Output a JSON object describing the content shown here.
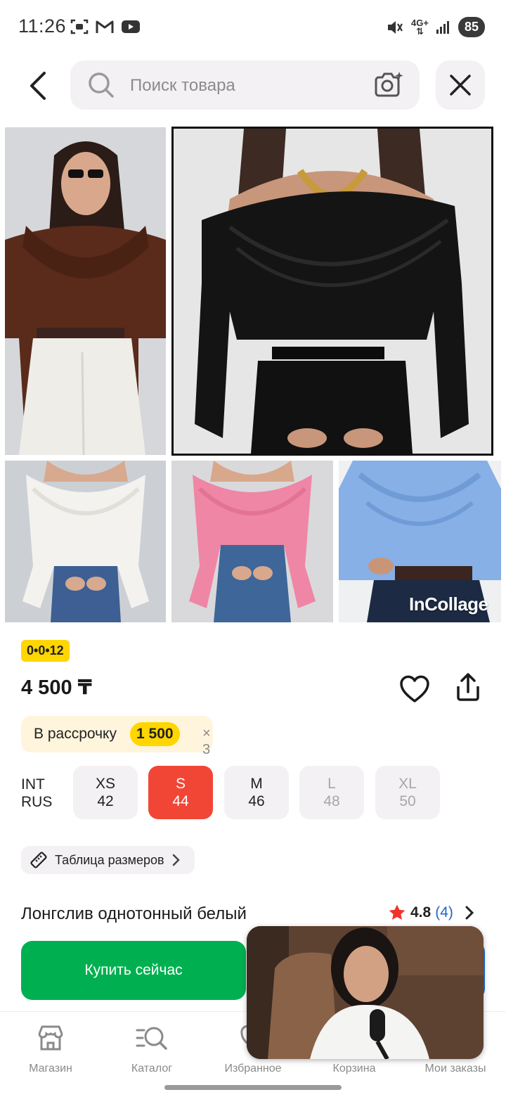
{
  "status_bar": {
    "time": "11:26",
    "network": "4G+",
    "battery": "85",
    "icons_left": [
      "screenshot-icon",
      "gmail-icon",
      "youtube-icon"
    ],
    "icons_right": [
      "mute-icon",
      "network-icon",
      "signal-icon",
      "battery-icon"
    ]
  },
  "header": {
    "search_placeholder": "Поиск товара",
    "icons": [
      "back-arrow-icon",
      "search-icon",
      "camera-search-icon",
      "close-icon"
    ]
  },
  "gallery": {
    "watermark": "InCollage",
    "photos": [
      "brown off-shoulder top",
      "black off-shoulder top",
      "white off-shoulder top",
      "pink off-shoulder top",
      "blue off-shoulder top"
    ]
  },
  "product": {
    "promo_badge": "0•0•12",
    "price": "4 500 ₸",
    "installment": {
      "label": "В рассрочку",
      "amount": "1 500",
      "multiplier": "× 3"
    },
    "size_legend": {
      "int": "INT",
      "rus": "RUS"
    },
    "sizes": [
      {
        "int": "XS",
        "rus": "42",
        "state": "available"
      },
      {
        "int": "S",
        "rus": "44",
        "state": "selected"
      },
      {
        "int": "M",
        "rus": "46",
        "state": "available"
      },
      {
        "int": "L",
        "rus": "48",
        "state": "unavailable"
      },
      {
        "int": "XL",
        "rus": "50",
        "state": "unavailable"
      }
    ],
    "size_table_label": "Таблица размеров",
    "title": "Лонгслив однотонный белый",
    "rating": "4.8",
    "reviews": "(4)"
  },
  "actions": {
    "buy_now": "Купить сейчас"
  },
  "bottom_nav": [
    {
      "label": "Магазин",
      "icon": "store-icon"
    },
    {
      "label": "Каталог",
      "icon": "catalog-search-icon"
    },
    {
      "label": "Избранное",
      "icon": "heart-icon"
    },
    {
      "label": "Корзина",
      "icon": "cart-icon"
    },
    {
      "label": "Мои заказы",
      "icon": "orders-icon"
    }
  ],
  "colors": {
    "accent_red": "#f14635",
    "buy_green": "#00b050",
    "promo_yellow": "#ffd600",
    "rating_star": "#f0332a",
    "link_blue": "#2066c8"
  }
}
